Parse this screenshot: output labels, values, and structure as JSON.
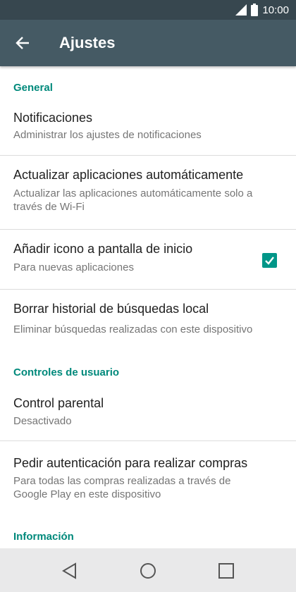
{
  "status_bar": {
    "time": "10:00",
    "icons": [
      "signal-icon",
      "battery-icon"
    ]
  },
  "app_bar": {
    "title": "Ajustes",
    "back_icon": "arrow-back-icon"
  },
  "sections": {
    "general": "General",
    "user_controls": "Controles de usuario",
    "info": "Información"
  },
  "items": {
    "notifications": {
      "title": "Notificaciones",
      "subtitle": "Administrar los ajustes de notificaciones"
    },
    "auto_update": {
      "title": "Actualizar aplicaciones automáticamente",
      "subtitle_1": "Actualizar las aplicaciones automáticamente solo a",
      "subtitle_2": "través de Wi-Fi"
    },
    "add_icon": {
      "title": "Añadir icono a pantalla de inicio",
      "subtitle": "Para nuevas aplicaciones",
      "checked": true
    },
    "clear_history": {
      "title": "Borrar historial de búsquedas  local",
      "subtitle": "Eliminar búsquedas realizadas con este dispositivo"
    },
    "parental": {
      "title": "Control parental",
      "subtitle": "Desactivado"
    },
    "purchase_auth": {
      "title": "Pedir autenticación para realizar compras",
      "subtitle_1": "Para todas las compras realizadas a través de",
      "subtitle_2": "Google Play en este dispositivo"
    }
  },
  "nav_bar": {
    "icons": [
      "back-triangle-icon",
      "home-circle-icon",
      "recents-square-icon"
    ]
  },
  "colors": {
    "status_bar": "#37474f",
    "app_bar": "#455a64",
    "accent": "#009688",
    "section_text": "#00897b",
    "nav_bar": "#e9e9ea"
  }
}
